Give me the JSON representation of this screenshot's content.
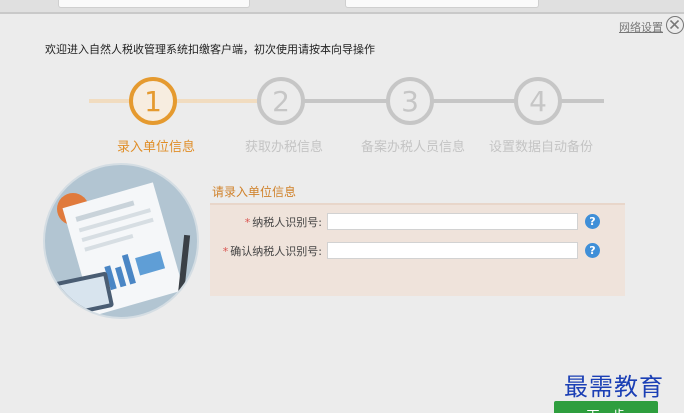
{
  "header": {
    "network_settings": "网络设置",
    "welcome": "欢迎进入自然人税收管理系统扣缴客户端，初次使用请按本向导操作"
  },
  "steps": [
    {
      "number": "1",
      "label": "录入单位信息",
      "active": true
    },
    {
      "number": "2",
      "label": "获取办税信息",
      "active": false
    },
    {
      "number": "3",
      "label": "备案办税人员信息",
      "active": false
    },
    {
      "number": "4",
      "label": "设置数据自动备份",
      "active": false
    }
  ],
  "form": {
    "title": "请录入单位信息",
    "required_mark": "*",
    "fields": [
      {
        "label": "纳税人识别号:",
        "value": ""
      },
      {
        "label": "确认纳税人识别号:",
        "value": ""
      }
    ],
    "help": "?"
  },
  "footer": {
    "next_label": "下一步",
    "watermark": "最需教育"
  },
  "colors": {
    "accent": "#e59a2f",
    "inactive": "#c6c6c6",
    "next_button": "#2e9e3e",
    "help_icon": "#3f8fd8"
  }
}
